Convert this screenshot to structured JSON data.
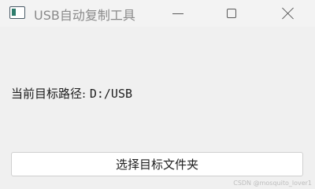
{
  "window": {
    "title": "USB自动复制工具",
    "app_icon": "window-app-icon",
    "controls": {
      "minimize_icon": "minimize-icon",
      "maximize_icon": "maximize-icon",
      "close_icon": "close-icon"
    }
  },
  "main": {
    "target_path_label": "当前目标路径:",
    "target_path_value": "D:/USB",
    "select_folder_button": "选择目标文件夹"
  },
  "watermark": "CSDN @mosquito_lover1",
  "colors": {
    "background": "#f0f0f0",
    "titlebar": "#f3f3f3",
    "button_bg": "#ffffff",
    "text": "#1e1e1e",
    "title_text": "#8a8a8a"
  }
}
